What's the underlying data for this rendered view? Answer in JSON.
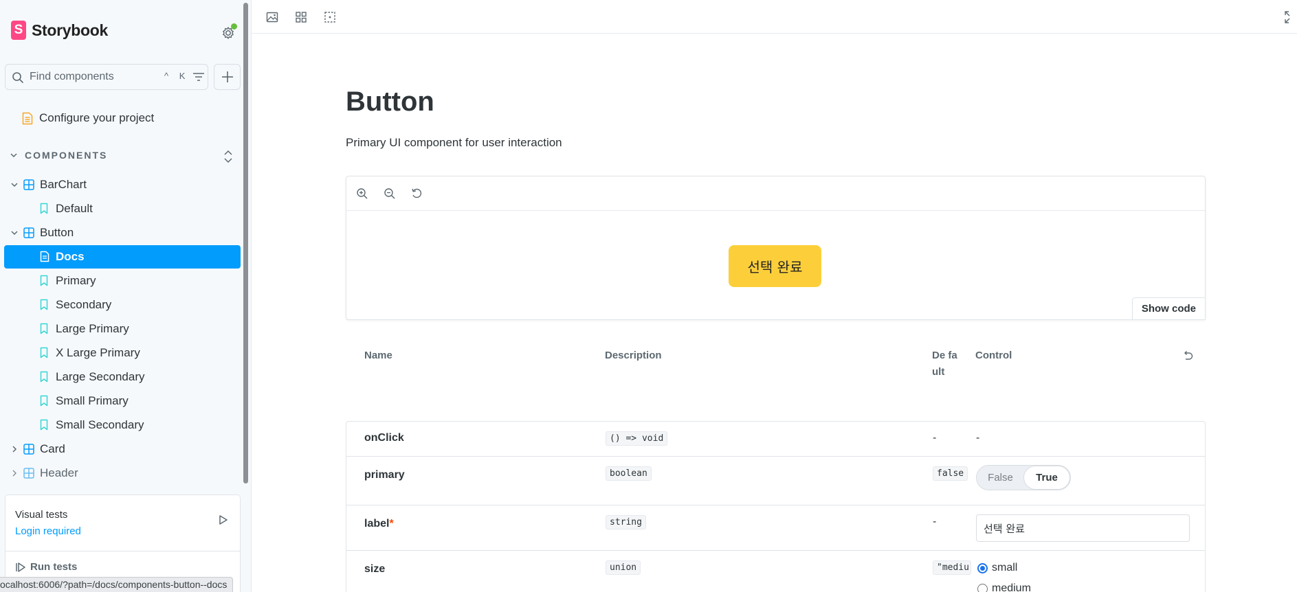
{
  "sidebar": {
    "brand": "Storybook",
    "brand_mark": "S",
    "search": {
      "placeholder": "Find components",
      "shortcut": "^ K"
    },
    "configure_label": "Configure your project",
    "section_label": "COMPONENTS",
    "tree": [
      {
        "label": "BarChart"
      },
      {
        "label": "Default"
      },
      {
        "label": "Button"
      },
      {
        "label": "Docs"
      },
      {
        "label": "Primary"
      },
      {
        "label": "Secondary"
      },
      {
        "label": "Large Primary"
      },
      {
        "label": "X Large Primary"
      },
      {
        "label": "Large Secondary"
      },
      {
        "label": "Small Primary"
      },
      {
        "label": "Small Secondary"
      },
      {
        "label": "Card"
      },
      {
        "label": "Header"
      }
    ],
    "visual_tests": {
      "title": "Visual tests",
      "login": "Login required",
      "run": "Run tests"
    }
  },
  "status_url": "ocalhost:6006/?path=/docs/components-button--docs",
  "doc": {
    "title": "Button",
    "description": "Primary UI component for user interaction",
    "demo_button_label": "선택 완료",
    "show_code": "Show code"
  },
  "args_table": {
    "headers": {
      "name": "Name",
      "description": "Description",
      "default": "De fa ult",
      "control": "Control"
    },
    "rows": [
      {
        "name": "onClick",
        "type": "() => void",
        "default": "-",
        "control": "-"
      },
      {
        "name": "primary",
        "type": "boolean",
        "default": "false",
        "toggle_false": "False",
        "toggle_true": "True"
      },
      {
        "name": "label",
        "required": "*",
        "type": "string",
        "default": "-",
        "value": "선택 완료"
      },
      {
        "name": "size",
        "type": "union",
        "default": "\"mediu",
        "options": [
          "small",
          "medium"
        ]
      }
    ]
  },
  "colors": {
    "accent": "#029cfd",
    "brand": "#ff4785",
    "demo_button": "#fccf3a",
    "status_dot": "#66bf3c"
  }
}
